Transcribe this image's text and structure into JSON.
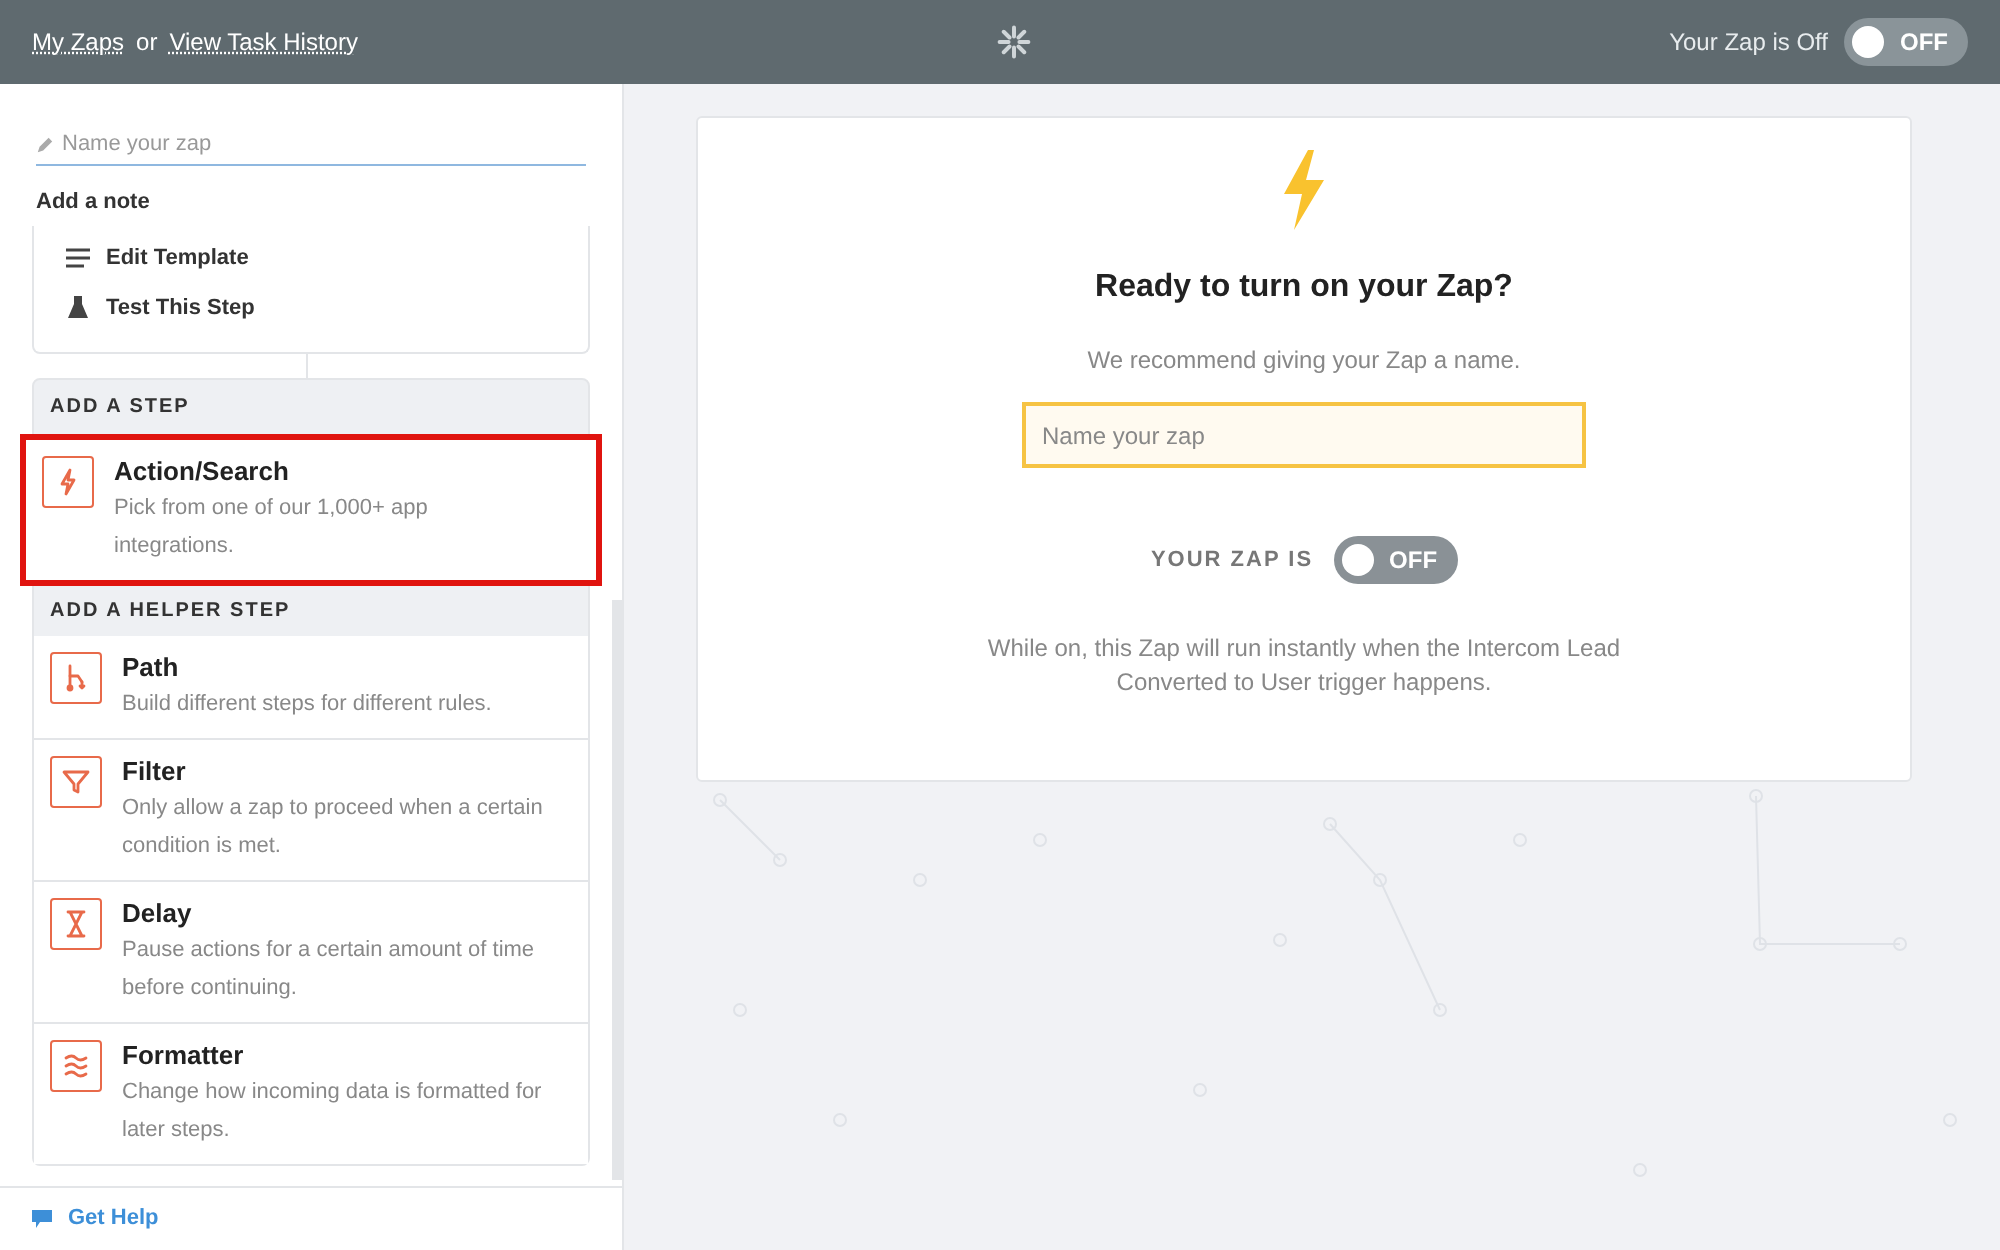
{
  "header": {
    "links": [
      "My Zaps",
      "View Task History"
    ],
    "separator": "or",
    "status_label": "Your Zap is Off",
    "toggle": {
      "on": false,
      "label": "OFF"
    }
  },
  "sidebar": {
    "name_field": {
      "placeholder": "Name your zap"
    },
    "note_link": "Add a note",
    "menu": [
      "Edit Template",
      "Test This Step"
    ],
    "add_step": {
      "heading": "ADD A STEP",
      "items": [
        {
          "title": "Action/Search",
          "description": "Pick from one of our 1,000+ app integrations.",
          "highlighted": true
        }
      ]
    },
    "helper_steps": {
      "heading": "ADD A HELPER STEP",
      "items": [
        {
          "title": "Path",
          "description": "Build different steps for different rules.",
          "highlighted": false
        },
        {
          "title": "Filter",
          "description": "Only allow a zap to proceed when a certain condition is met.",
          "highlighted": false
        },
        {
          "title": "Delay",
          "description": "Pause actions for a certain amount of time before continuing.",
          "highlighted": false
        },
        {
          "title": "Formatter",
          "description": "Change how incoming data is formatted for later steps.",
          "highlighted": false
        }
      ]
    },
    "help_link": "Get Help"
  },
  "card": {
    "title": "Ready to turn on your Zap?",
    "subtitle": "We recommend giving your Zap a name.",
    "name_field": {
      "placeholder": "Name your zap"
    },
    "toggle_label": "YOUR ZAP IS",
    "toggle": {
      "on": false,
      "label": "OFF"
    },
    "note": "While on, this Zap will run instantly when the Intercom Lead Converted to User trigger happens."
  }
}
